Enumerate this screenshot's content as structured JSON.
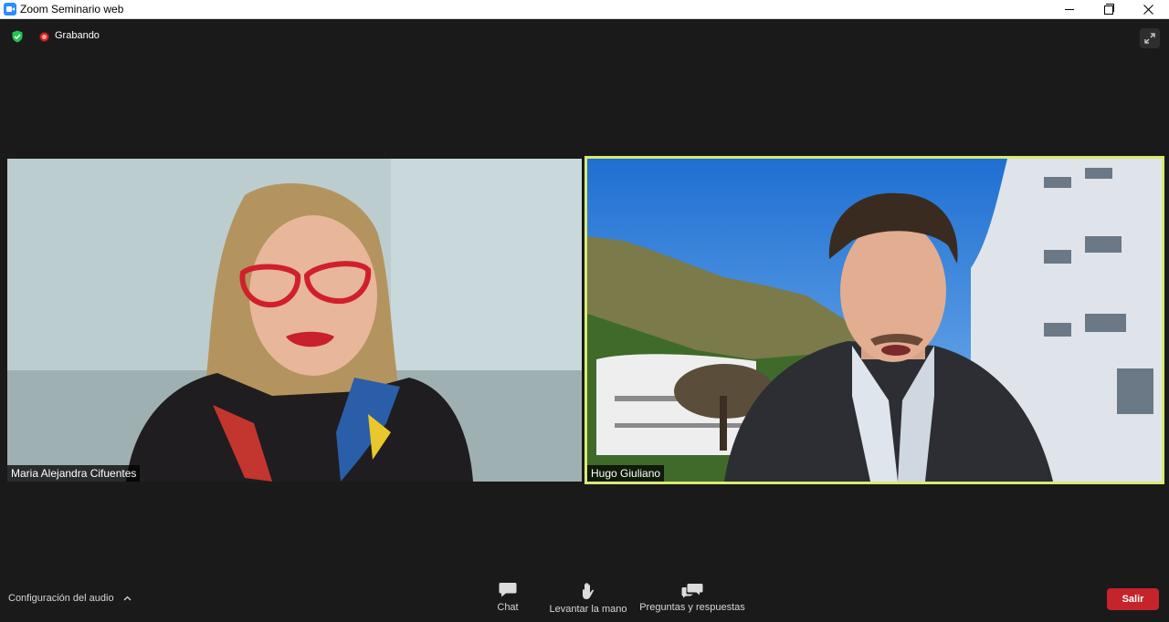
{
  "window": {
    "title": "Zoom Seminario web"
  },
  "status": {
    "recording_label": "Grabando"
  },
  "participants": [
    {
      "name": "Maria Alejandra Cifuentes"
    },
    {
      "name": "Hugo Giuliano"
    }
  ],
  "toolbar": {
    "audio_settings_label": "Configuración del audio",
    "chat_label": "Chat",
    "raise_hand_label": "Levantar la mano",
    "qa_label": "Preguntas y respuestas",
    "leave_label": "Salir"
  },
  "colors": {
    "brand": "#2d8cff",
    "active_speaker_border": "#d8ea76",
    "leave_button": "#c5242b",
    "security_shield": "#23c552",
    "recording": "#e02828"
  }
}
